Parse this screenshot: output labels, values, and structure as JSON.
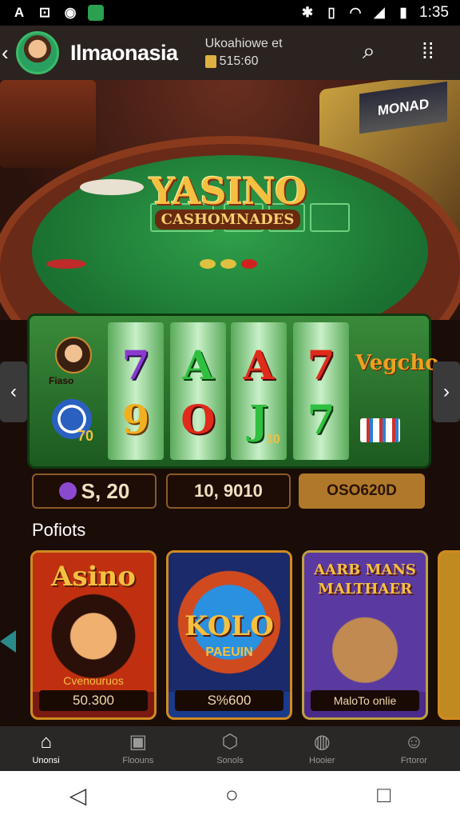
{
  "status_bar": {
    "time": "1:35",
    "left_icons": [
      "a-icon",
      "cast-icon",
      "circle-icon",
      "green-app-icon"
    ],
    "right_icons": [
      "bluetooth-icon",
      "sim-icon",
      "wifi-icon",
      "signal-icon",
      "battery-icon"
    ]
  },
  "header": {
    "title": "Ilmaonasia",
    "account_name": "Ukoahiowe et",
    "balance": "515:60"
  },
  "hero": {
    "logo_title": "YASINO",
    "logo_subtitle": "CASHOMNADES",
    "machine_screen": "MONAD"
  },
  "slot": {
    "reels": [
      {
        "top": "7",
        "bottom": "9"
      },
      {
        "top": "A",
        "bottom": "O"
      },
      {
        "top": "A",
        "bottom": "J"
      },
      {
        "top": "7",
        "bottom": "7"
      }
    ],
    "side_label": "Fiaso",
    "side_value": "70",
    "reel3_badge": "10",
    "vegas_label": "Vegcho"
  },
  "stats": [
    {
      "value": "S, 20"
    },
    {
      "value": "10, 9010"
    },
    {
      "value": "OSO620D"
    }
  ],
  "section_title": "Pofiots",
  "cards": [
    {
      "title": "Asino",
      "caption": "Cvenouruos",
      "price": "50.300"
    },
    {
      "title": "KOLO",
      "subtitle": "PAEUIN",
      "price": "S%600"
    },
    {
      "title": "AARB MANS MALTHAER",
      "price": "MaloTo onlie"
    }
  ],
  "bottom_nav": [
    {
      "label": "Unonsi",
      "icon": "home-icon",
      "active": true
    },
    {
      "label": "Floouns",
      "icon": "rooms-icon",
      "active": false
    },
    {
      "label": "Sonols",
      "icon": "shield-icon",
      "active": false
    },
    {
      "label": "Hooier",
      "icon": "globe-icon",
      "active": false
    },
    {
      "label": "Frtoror",
      "icon": "profile-icon",
      "active": false
    }
  ],
  "system_nav": [
    "back-icon",
    "home-circle-icon",
    "recents-icon"
  ],
  "colors": {
    "felt": "#1a7030",
    "gold": "#f5c040",
    "header_bg": "#2a2320"
  }
}
